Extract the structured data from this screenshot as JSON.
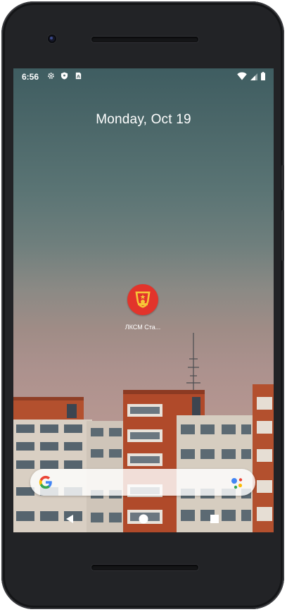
{
  "status_bar": {
    "time": "6:56",
    "left_icons": [
      "gear-icon",
      "shield-icon",
      "sim-card-icon"
    ],
    "right_icons": [
      "wifi-icon",
      "cell-signal-icon",
      "battery-icon"
    ]
  },
  "home": {
    "date": "Monday, Oct 19",
    "apps": [
      {
        "label": "ЛКСМ Ста...",
        "icon": "komsomol-badge-icon",
        "color": "#e2342b"
      }
    ]
  },
  "search_bar": {
    "logo": "google-g-icon",
    "assistant": "google-assistant-dots-icon"
  },
  "nav_bar": {
    "buttons": [
      "back-button",
      "home-button",
      "recents-button"
    ]
  },
  "colors": {
    "google_blue": "#4285F4",
    "google_red": "#EA4335",
    "google_yellow": "#FBBC05",
    "google_green": "#34A853",
    "app_red": "#e2342b"
  }
}
